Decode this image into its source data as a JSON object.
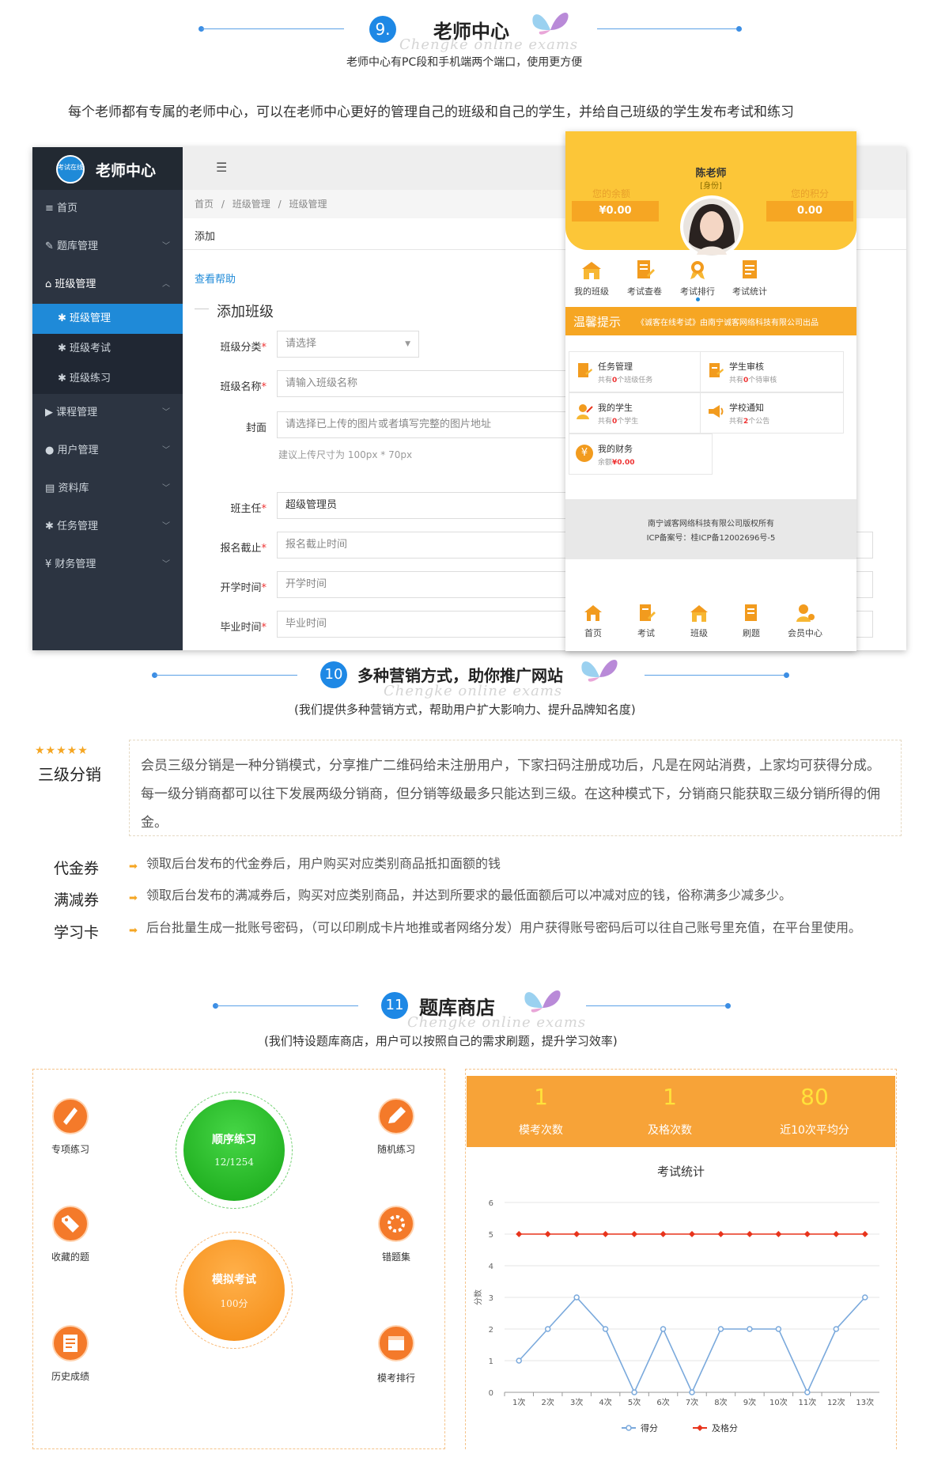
{
  "section9": {
    "number": "9.",
    "title": "老师中心",
    "subtitle": "老师中心有PC段和手机端两个端口，使用更方便",
    "watermark": "Chengke online exams",
    "description": "每个老师都有专属的老师中心，可以在老师中心更好的管理自己的班级和自己的学生，并给自己班级的学生发布考试和练习"
  },
  "pc": {
    "logo_badge": "考试在线",
    "brand": "老师中心",
    "menu_toggle": "☰",
    "sidebar": [
      {
        "icon": "≡",
        "label": "首页"
      },
      {
        "icon": "✎",
        "label": "题库管理"
      },
      {
        "icon": "⌂",
        "label": "班级管理"
      },
      {
        "icon": "▶",
        "label": "课程管理"
      },
      {
        "icon": "●",
        "label": "用户管理"
      },
      {
        "icon": "▤",
        "label": "资料库"
      },
      {
        "icon": "✱",
        "label": "任务管理"
      },
      {
        "icon": "¥",
        "label": "财务管理"
      }
    ],
    "sub_items": [
      {
        "icon": "✱",
        "label": "班级管理"
      },
      {
        "icon": "✱",
        "label": "班级考试"
      },
      {
        "icon": "✱",
        "label": "班级练习"
      }
    ],
    "breadcrumb": [
      "首页",
      "班级管理",
      "班级管理"
    ],
    "breadcrumb_sep": "/",
    "tab_add": "添加",
    "help_link": "查看帮助",
    "form_title": "添加班级",
    "required_mark": "*",
    "fields": {
      "category": {
        "label": "班级分类",
        "value": "请选择"
      },
      "name": {
        "label": "班级名称",
        "placeholder": "请输入班级名称"
      },
      "cover": {
        "label": "封面",
        "placeholder": "请选择已上传的图片或者填写完整的图片地址",
        "hint": "建议上传尺寸为 100px * 70px"
      },
      "teacher": {
        "label": "班主任",
        "value": "超级管理员"
      },
      "deadline": {
        "label": "报名截止",
        "placeholder": "报名截止时间"
      },
      "start": {
        "label": "开学时间",
        "placeholder": "开学时间"
      },
      "end": {
        "label": "毕业时间",
        "placeholder": "毕业时间"
      }
    }
  },
  "mobile": {
    "teacher_name": "陈老师",
    "identity": "[身份]",
    "balance_label": "您的余额",
    "balance_value": "¥0.00",
    "points_label": "您的积分",
    "points_value": "0.00",
    "quick": [
      "我的班级",
      "考试查卷",
      "考试排行",
      "考试统计"
    ],
    "notice_title": "温馨提示",
    "notice_text": "《诚客在线考试》由南宁诚客网络科技有限公司出品",
    "cards": [
      {
        "title": "任务管理",
        "pre": "共有",
        "count": "0",
        "post": "个班级任务"
      },
      {
        "title": "学生审核",
        "pre": "共有",
        "count": "0",
        "post": "个待审核"
      },
      {
        "title": "我的学生",
        "pre": "共有",
        "count": "0",
        "post": "个学生"
      },
      {
        "title": "学校通知",
        "pre": "共有",
        "count": "2",
        "post": "个公告"
      },
      {
        "title": "我的财务",
        "pre": "余额",
        "count": "¥0.00",
        "post": ""
      }
    ],
    "copyright": "南宁诚客网络科技有限公司版权所有",
    "icp": "ICP备案号：桂ICP备12002696号-5",
    "bottom_nav": [
      "首页",
      "考试",
      "班级",
      "刷题",
      "会员中心"
    ]
  },
  "section10": {
    "number": "10",
    "title": "多种营销方式，助你推广网站",
    "subtitle": "(我们提供多种营销方式，帮助用户扩大影响力、提升品牌知名度)",
    "watermark": "Chengke online exams",
    "stars": "★★★★★",
    "distribution_label": "三级分销",
    "distribution_text": "会员三级分销是一种分销模式，分享推广二维码给未注册用户，下家扫码注册成功后，凡是在网站消费，上家均可获得分成。每一级分销商都可以往下发展两级分销商，但分销等级最多只能达到三级。在这种模式下，分销商只能获取三级分销所得的佣金。",
    "features": [
      {
        "label": "代金券",
        "text": "领取后台发布的代金券后，用户购买对应类别商品抵扣面额的钱"
      },
      {
        "label": "满减券",
        "text": "领取后台发布的满减券后，购买对应类别商品，并达到所要求的最低面额后可以冲减对应的钱，俗称满多少减多少。"
      },
      {
        "label": "学习卡",
        "text": "后台批量生成一批账号密码，（可以印刷成卡片地推或者网络分发）用户获得账号密码后可以往自己账号里充值，在平台里使用。"
      }
    ]
  },
  "section11": {
    "number": "11",
    "title": "题库商店",
    "subtitle": "(我们特设题库商店，用户可以按照自己的需求刷题，提升学习效率)",
    "watermark": "Chengke online exams",
    "practice": [
      {
        "label": "专项练习"
      },
      {
        "label": "随机练习"
      },
      {
        "label": "收藏的题"
      },
      {
        "label": "错题集"
      },
      {
        "label": "历史成绩"
      },
      {
        "label": "模考排行"
      }
    ],
    "seq_title": "顺序练习",
    "seq_value": "12/1254",
    "mock_title": "模拟考试",
    "mock_value": "100分",
    "stats": [
      {
        "value": "1",
        "label": "模考次数"
      },
      {
        "value": "1",
        "label": "及格次数"
      },
      {
        "value": "80",
        "label": "近10次平均分"
      }
    ]
  },
  "chart_data": {
    "type": "line",
    "title": "考试统计",
    "ylabel": "分数",
    "categories": [
      "1次",
      "2次",
      "3次",
      "4次",
      "5次",
      "6次",
      "7次",
      "8次",
      "9次",
      "10次",
      "11次",
      "12次",
      "13次"
    ],
    "series": [
      {
        "name": "得分",
        "values": [
          1,
          2,
          3,
          2,
          0,
          2,
          0,
          2,
          2,
          2,
          0,
          2,
          3
        ],
        "color": "#7aa9dc"
      },
      {
        "name": "及格分",
        "values": [
          5,
          5,
          5,
          5,
          5,
          5,
          5,
          5,
          5,
          5,
          5,
          5,
          5
        ],
        "color": "#e8341c"
      }
    ],
    "ylim": [
      0,
      6
    ],
    "yticks": [
      "0",
      "1",
      "2",
      "3",
      "4",
      "5",
      "6"
    ],
    "grid": true,
    "legend": "bottom"
  }
}
